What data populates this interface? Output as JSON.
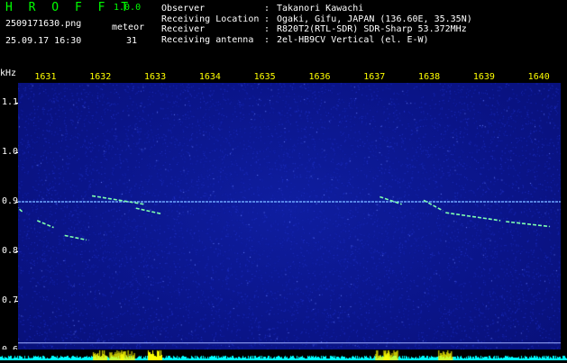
{
  "header": {
    "app_name": "H R O F F T",
    "version": "1.0.0",
    "filename": "2509171630.png",
    "datetime": "25.09.17 16:30",
    "meteor_label": "meteor",
    "meteor_count": "31",
    "info": [
      {
        "key": "Observer",
        "sep": ":",
        "value": "Takanori Kawachi"
      },
      {
        "key": "Receiving Location",
        "sep": ":",
        "value": "Ogaki, Gifu, JAPAN (136.60E, 35.35N)"
      },
      {
        "key": "Receiver",
        "sep": ":",
        "value": "R820T2(RTL-SDR) SDR-Sharp 53.372MHz"
      },
      {
        "key": "Receiving antenna",
        "sep": ":",
        "value": "2el-HB9CV Vertical (el. E-W)"
      }
    ]
  },
  "colors": {
    "accent": "#00ff00",
    "tick_labels": "#ffff00",
    "plot_bg": "#0a1488",
    "noise": "#2a40d0",
    "trace": "#7fffb0",
    "bottom_trace": "#00ffff",
    "bursts": "#ffff00"
  },
  "chart_data": {
    "type": "heatmap",
    "title": "",
    "y_unit": "kHz",
    "xlabel": "",
    "ylabel": "kHz",
    "x_ticks": [
      "1631",
      "1632",
      "1633",
      "1634",
      "1635",
      "1636",
      "1637",
      "1638",
      "1639",
      "1640"
    ],
    "x_range": [
      1630.5,
      1640.4
    ],
    "y_ticks": [
      "1.1",
      "1.0",
      "0.9",
      "0.8",
      "0.7",
      "0.6"
    ],
    "y_range": [
      0.58,
      1.14
    ],
    "carrier_khz": 0.9,
    "trails": [
      {
        "name": "",
        "points": [
          [
            1630.45,
            0.892
          ],
          [
            1630.6,
            0.878
          ]
        ]
      },
      {
        "name": "",
        "points": [
          [
            1630.85,
            0.862
          ],
          [
            1631.15,
            0.848
          ]
        ]
      },
      {
        "name": "",
        "points": [
          [
            1631.35,
            0.832
          ],
          [
            1631.75,
            0.823
          ]
        ]
      },
      {
        "name": "",
        "points": [
          [
            1631.85,
            0.912
          ],
          [
            1632.8,
            0.895
          ]
        ]
      },
      {
        "name": "",
        "points": [
          [
            1632.65,
            0.887
          ],
          [
            1633.1,
            0.876
          ]
        ]
      },
      {
        "name": "",
        "points": [
          [
            1637.1,
            0.91
          ],
          [
            1637.5,
            0.895
          ]
        ]
      },
      {
        "name": "",
        "points": [
          [
            1637.9,
            0.903
          ],
          [
            1638.25,
            0.882
          ]
        ]
      },
      {
        "name": "",
        "points": [
          [
            1638.3,
            0.878
          ],
          [
            1639.3,
            0.862
          ]
        ]
      },
      {
        "name": "",
        "points": [
          [
            1639.4,
            0.86
          ],
          [
            1640.2,
            0.85
          ]
        ]
      }
    ],
    "burst_ticks": [
      1632.0,
      1632.3,
      1632.5,
      1633.0,
      1637.15,
      1637.3,
      1638.3
    ],
    "grid": false
  }
}
